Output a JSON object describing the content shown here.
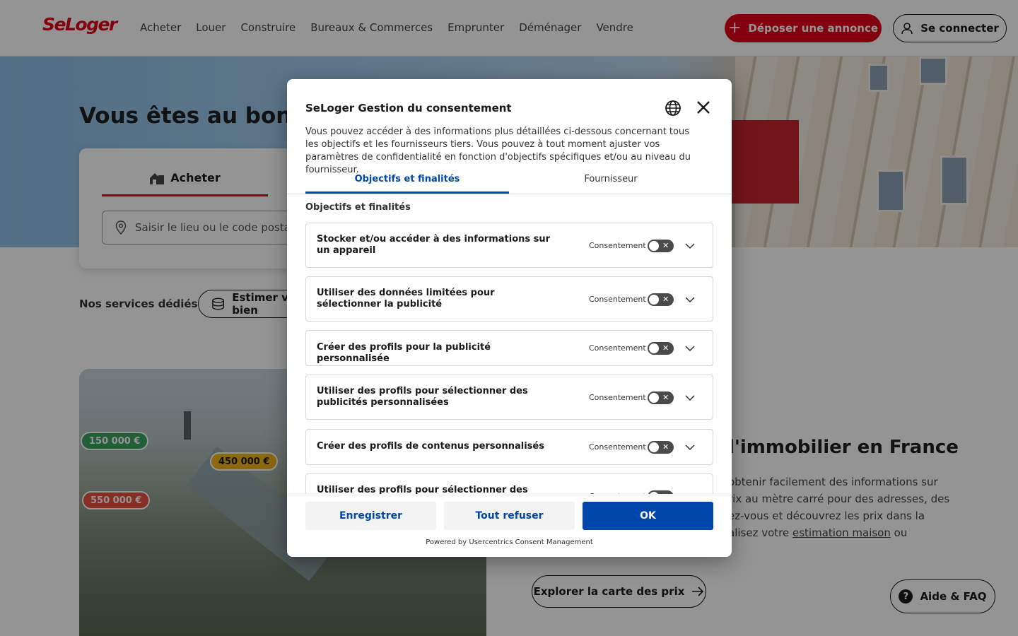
{
  "header": {
    "logo": "SeLoger",
    "nav": [
      "Acheter",
      "Louer",
      "Construire",
      "Bureaux & Commerces",
      "Emprunter",
      "Déménager",
      "Vendre"
    ],
    "deposer_label": "Déposer une annonce",
    "login_label": "Se connecter"
  },
  "hero": {
    "title": "Vous êtes au bon endroit",
    "tab_label": "Acheter",
    "location_placeholder": "Saisir le lieu ou le code postal"
  },
  "services": {
    "label": "Nos services dédiés :",
    "estimer_label": "Estimer votre bien"
  },
  "prices": {
    "tag1": "150 000 €",
    "tag2": "450 000 €",
    "tag3": "550 000 €"
  },
  "immobilier": {
    "title": "l'immobilier en France",
    "text": "obtenir facilement des informations sur\nrix au mètre carré pour des adresses, des\nez-vous et découvrez les prix dans la\nalisez votre",
    "link": "estimation maison",
    "text_end": " ou",
    "explore_label": "Explorer la carte des prix"
  },
  "help": {
    "label": "Aide & FAQ"
  },
  "consent": {
    "title": "SeLoger Gestion du consentement",
    "description": "Vous pouvez accéder à des informations plus détaillées ci-dessous concernant tous les objectifs et les fournisseurs tiers. Vous pouvez à tout moment ajuster vos paramètres de confidentialité en fonction d'objectifs spécifiques et/ou au niveau du fournisseur.",
    "tabs": [
      "Objectifs et finalités",
      "Fournisseur"
    ],
    "section_label": "Objectifs et finalités",
    "consent_label": "Consentement",
    "purposes": [
      "Stocker et/ou accéder à des informations sur un appareil",
      "Utiliser des données limitées pour sélectionner la publicité",
      "Créer des profils pour la publicité personnalisée",
      "Utiliser des profils pour sélectionner des publicités personnalisées",
      "Créer des profils de contenus personnalisés",
      "Utiliser des profils pour sélectionner des contenus"
    ],
    "buttons": {
      "save": "Enregistrer",
      "refuse": "Tout refuser",
      "ok": "OK"
    },
    "powered": "Powered by Usercentrics Consent Management"
  },
  "colors": {
    "brand": "#e2001a",
    "consent_blue": "#0047ab"
  }
}
